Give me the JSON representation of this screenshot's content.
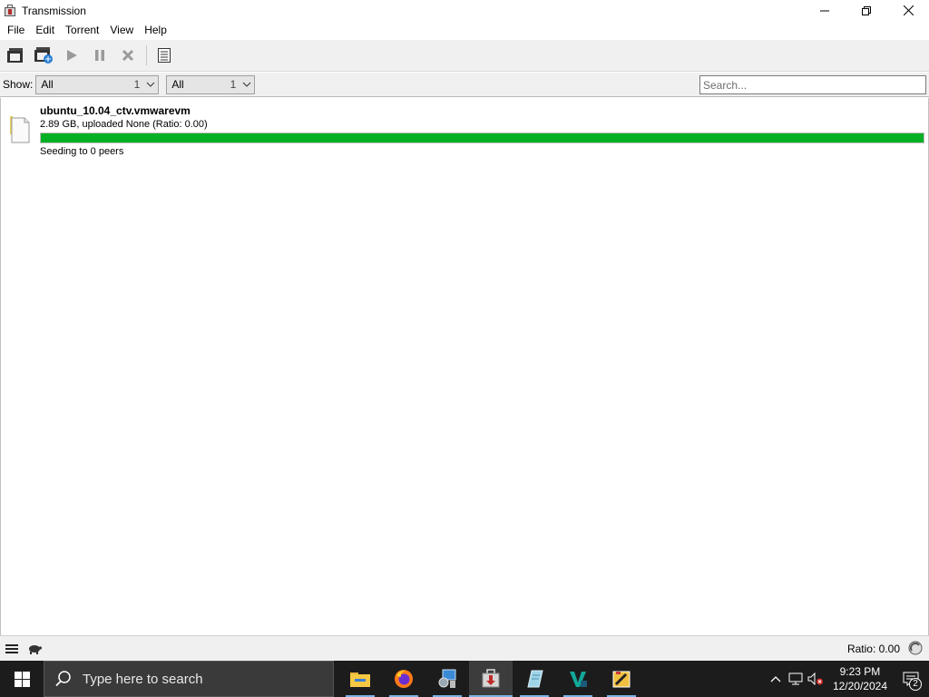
{
  "window": {
    "title": "Transmission"
  },
  "menu": {
    "items": [
      "File",
      "Edit",
      "Torrent",
      "View",
      "Help"
    ]
  },
  "toolbar": {
    "buttons": [
      "open-torrent",
      "open-url",
      "start",
      "pause",
      "remove",
      "properties"
    ]
  },
  "filter": {
    "show_label": "Show:",
    "status_filter": {
      "value": "All",
      "count": "1"
    },
    "tracker_filter": {
      "value": "All",
      "count": "1"
    },
    "search_placeholder": "Search..."
  },
  "torrents": [
    {
      "name": "ubuntu_10.04_ctv.vmwarevm",
      "info": "2.89 GB, uploaded None (Ratio: 0.00)",
      "progress": 1.0,
      "status": "Seeding to 0 peers"
    }
  ],
  "statusbar": {
    "ratio_text": "Ratio: 0.00"
  },
  "taskbar": {
    "search_placeholder": "Type here to search",
    "apps": [
      "file-explorer",
      "firefox",
      "control-panel",
      "transmission",
      "notepad",
      "vscode-like",
      "paint"
    ],
    "active_app": "transmission",
    "time": "9:23 PM",
    "date": "12/20/2024",
    "notification_count": "2"
  },
  "colors": {
    "progress_fill": "#06b025",
    "taskbar_bg": "#1c1c1c",
    "toolbar_bg": "#f0f0f0"
  }
}
